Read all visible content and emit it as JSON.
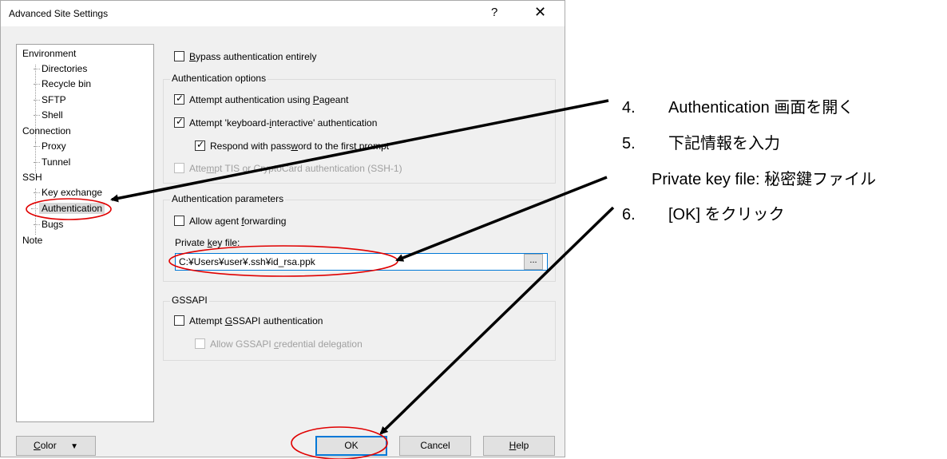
{
  "window": {
    "title": "Advanced Site Settings",
    "help_glyph": "?",
    "close_glyph": "✕"
  },
  "tree": {
    "items": [
      {
        "label": "Environment"
      },
      {
        "label": "Directories"
      },
      {
        "label": "Recycle bin"
      },
      {
        "label": "SFTP"
      },
      {
        "label": "Shell"
      },
      {
        "label": "Connection"
      },
      {
        "label": "Proxy"
      },
      {
        "label": "Tunnel"
      },
      {
        "label": "SSH"
      },
      {
        "label": "Key exchange"
      },
      {
        "label": "Authentication"
      },
      {
        "label": "Bugs"
      },
      {
        "label": "Note"
      }
    ],
    "selected": "Authentication"
  },
  "bypass": {
    "label_pre": "",
    "label_u": "B",
    "label_post": "ypass authentication entirely",
    "checked": false
  },
  "auth_options": {
    "title": "Authentication options",
    "pageant": {
      "label_pre": "Attempt authentication using ",
      "label_u": "P",
      "label_post": "ageant",
      "checked": true
    },
    "keyboard": {
      "label_pre": "Attempt 'keyboard-",
      "label_u": "i",
      "label_post": "nteractive' authentication",
      "checked": true
    },
    "respond": {
      "label_pre": "Respond with pass",
      "label_u": "w",
      "label_post": "ord to the first prompt",
      "checked": true
    },
    "tis": {
      "label_pre": "Atte",
      "label_u": "m",
      "label_post": "pt TIS or CryptoCard authentication (SSH-1)",
      "checked": false
    }
  },
  "auth_params": {
    "title": "Authentication parameters",
    "agent_fwd": {
      "label_pre": "Allow agent ",
      "label_u": "f",
      "label_post": "orwarding",
      "checked": false
    },
    "key_label_pre": "Private ",
    "key_label_u": "k",
    "key_label_post": "ey file:",
    "key_value": "C:¥Users¥user¥.ssh¥id_rsa.ppk",
    "browse_label": "..."
  },
  "gssapi": {
    "title": "GSSAPI",
    "attempt": {
      "label_pre": "Attempt ",
      "label_u": "G",
      "label_post": "SSAPI authentication",
      "checked": false
    },
    "delegation": {
      "label_pre": "Allow GSSAPI ",
      "label_u": "c",
      "label_post": "redential delegation",
      "checked": false
    }
  },
  "buttons": {
    "color_pre": "",
    "color_u": "C",
    "color_post": "olor",
    "color_arrow": "▼",
    "ok": "OK",
    "cancel": "Cancel",
    "help_pre": "",
    "help_u": "H",
    "help_post": "elp"
  },
  "annotations": {
    "step4_num": "4.",
    "step4_text": "Authentication 画面を開く",
    "step5_num": "5.",
    "step5_text": "下記情報を入力",
    "step5_sub": "Private key file: 秘密鍵ファイル",
    "step6_num": "6.",
    "step6_text": "[OK] をクリック",
    "color": "#000000",
    "highlight_color": "#e00000"
  }
}
